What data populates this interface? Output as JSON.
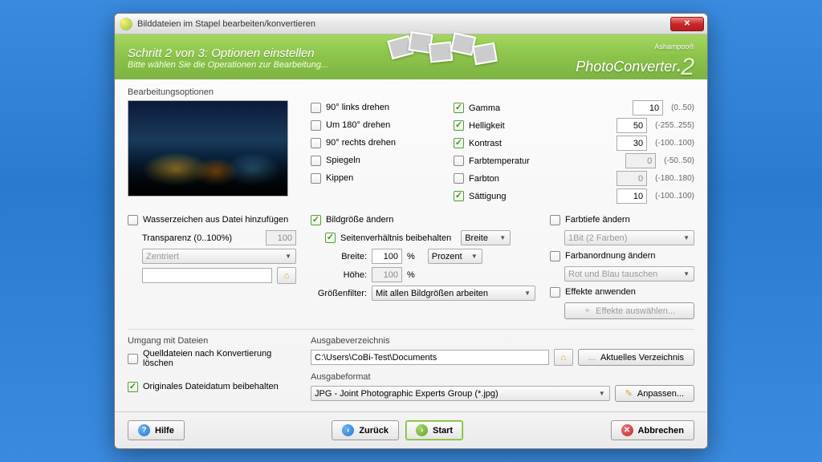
{
  "window": {
    "title": "Bilddateien im Stapel bearbeiten/konvertieren"
  },
  "banner": {
    "step": "Schritt 2 von 3: Optionen einstellen",
    "subtitle": "Bitte wählen Sie die Operationen zur Bearbeitung...",
    "brand_prefix": "Ashampoo®",
    "brand_name": "PhotoConverter",
    "brand_version": "2"
  },
  "sections": {
    "edit_options": "Bearbeitungsoptionen",
    "file_handling": "Umgang mit Dateien",
    "output_dir": "Ausgabeverzeichnis",
    "output_format": "Ausgabeformat"
  },
  "rotations": {
    "rotate_left": "90° links drehen",
    "rotate_180": "Um 180° drehen",
    "rotate_right": "90° rechts drehen",
    "mirror": "Spiegeln",
    "flip": "Kippen"
  },
  "adjust": {
    "gamma": {
      "label": "Gamma",
      "value": "10",
      "range": "(0..50)"
    },
    "brightness": {
      "label": "Helligkeit",
      "value": "50",
      "range": "(-255..255)"
    },
    "contrast": {
      "label": "Kontrast",
      "value": "30",
      "range": "(-100..100)"
    },
    "color_temp": {
      "label": "Farbtemperatur",
      "value": "0",
      "range": "(-50..50)"
    },
    "hue": {
      "label": "Farbton",
      "value": "0",
      "range": "(-180..180)"
    },
    "saturation": {
      "label": "Sättigung",
      "value": "10",
      "range": "(-100..100)"
    }
  },
  "watermark": {
    "add_label": "Wasserzeichen aus Datei hinzufügen",
    "transparency_label": "Transparenz (0..100%)",
    "transparency_value": "100",
    "position": "Zentriert",
    "file_value": ""
  },
  "resize": {
    "change_size": "Bildgröße ändern",
    "keep_aspect": "Seitenverhältnis beibehalten",
    "aspect_mode": "Breite",
    "width_label": "Breite:",
    "height_label": "Höhe:",
    "width_value": "100",
    "height_value": "100",
    "percent_suffix": "%",
    "unit": "Prozent",
    "size_filter_label": "Größenfilter:",
    "size_filter_value": "Mit allen Bildgrößen arbeiten"
  },
  "right_opts": {
    "color_depth_label": "Farbtiefe ändern",
    "color_depth_value": "1Bit (2 Farben)",
    "color_order_label": "Farbanordnung ändern",
    "color_order_value": "Rot und Blau tauschen",
    "effects_label": "Effekte anwenden",
    "effects_button": "Effekte auswählen..."
  },
  "file_handling": {
    "delete_after": "Quelldateien nach Konvertierung löschen",
    "keep_date": "Originales Dateidatum beibehalten"
  },
  "output": {
    "dir_value": "C:\\Users\\CoBi-Test\\Documents",
    "current_dir_btn": "Aktuelles Verzeichnis",
    "format_value": "JPG - Joint Photographic Experts Group (*.jpg)",
    "adjust_btn": "Anpassen..."
  },
  "buttons": {
    "help": "Hilfe",
    "back": "Zurück",
    "start": "Start",
    "cancel": "Abbrechen"
  }
}
